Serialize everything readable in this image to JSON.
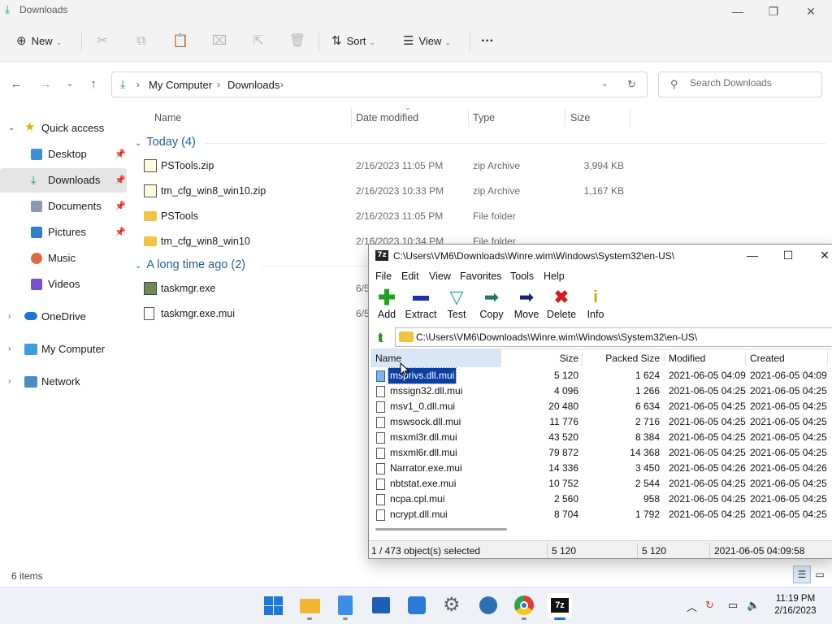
{
  "explorer": {
    "title": "Downloads",
    "commands": {
      "new": "New",
      "sort": "Sort",
      "view": "View",
      "more": "···"
    },
    "breadcrumb": [
      "My Computer",
      "Downloads"
    ],
    "search_placeholder": "Search Downloads",
    "columns": {
      "name": "Name",
      "date": "Date modified",
      "type": "Type",
      "size": "Size"
    },
    "sidebar": {
      "quick_access": "Quick access",
      "items": [
        {
          "label": "Desktop",
          "pinned": true
        },
        {
          "label": "Downloads",
          "pinned": true,
          "active": true
        },
        {
          "label": "Documents",
          "pinned": true
        },
        {
          "label": "Pictures",
          "pinned": true
        },
        {
          "label": "Music"
        },
        {
          "label": "Videos"
        }
      ],
      "onedrive": "OneDrive",
      "my_computer": "My Computer",
      "network": "Network"
    },
    "groups": [
      {
        "label": "Today (4)",
        "files": [
          {
            "name": "PSTools.zip",
            "date": "2/16/2023 11:05 PM",
            "type": "zip Archive",
            "size": "3,994 KB",
            "icon": "zip-icon"
          },
          {
            "name": "tm_cfg_win8_win10.zip",
            "date": "2/16/2023 10:33 PM",
            "type": "zip Archive",
            "size": "1,167 KB",
            "icon": "zip-icon"
          },
          {
            "name": "PSTools",
            "date": "2/16/2023 11:05 PM",
            "type": "File folder",
            "size": "",
            "icon": "folder-icon"
          },
          {
            "name": "tm_cfg_win8_win10",
            "date": "2/16/2023 10:34 PM",
            "type": "File folder",
            "size": "",
            "icon": "folder-icon"
          }
        ]
      },
      {
        "label": "A long time ago (2)",
        "files": [
          {
            "name": "taskmgr.exe",
            "date": "6/5",
            "type": "",
            "size": "",
            "icon": "exe-icon"
          },
          {
            "name": "taskmgr.exe.mui",
            "date": "6/5",
            "type": "",
            "size": "",
            "icon": "file-icon"
          }
        ]
      }
    ],
    "status": "6 items"
  },
  "sevenzip": {
    "title": "C:\\Users\\VM6\\Downloads\\Winre.wim\\Windows\\System32\\en-US\\",
    "logo": "7z",
    "menu": [
      "File",
      "Edit",
      "View",
      "Favorites",
      "Tools",
      "Help"
    ],
    "toolbar": [
      {
        "label": "Add",
        "icon": "add-icon",
        "color": "#1fa01f"
      },
      {
        "label": "Extract",
        "icon": "extract-icon",
        "color": "#1c2fa8"
      },
      {
        "label": "Test",
        "icon": "test-icon",
        "color": "#1ba6b8"
      },
      {
        "label": "Copy",
        "icon": "copy-arrow-icon",
        "color": "#1a7a5a"
      },
      {
        "label": "Move",
        "icon": "move-arrow-icon",
        "color": "#15207a"
      },
      {
        "label": "Delete",
        "icon": "delete-icon",
        "color": "#d51c1c"
      },
      {
        "label": "Info",
        "icon": "info-icon",
        "color": "#c9a800"
      }
    ],
    "path": "C:\\Users\\VM6\\Downloads\\Winre.wim\\Windows\\System32\\en-US\\",
    "columns": {
      "name": "Name",
      "size": "Size",
      "packed": "Packed Size",
      "modified": "Modified",
      "created": "Created"
    },
    "files": [
      {
        "name": "msprivs.dll.mui",
        "size": "5 120",
        "packed": "1 624",
        "modified": "2021-06-05 04:09",
        "created": "2021-06-05 04:09",
        "selected": true
      },
      {
        "name": "mssign32.dll.mui",
        "size": "4 096",
        "packed": "1 266",
        "modified": "2021-06-05 04:25",
        "created": "2021-06-05 04:25"
      },
      {
        "name": "msv1_0.dll.mui",
        "size": "20 480",
        "packed": "6 634",
        "modified": "2021-06-05 04:25",
        "created": "2021-06-05 04:25"
      },
      {
        "name": "mswsock.dll.mui",
        "size": "11 776",
        "packed": "2 716",
        "modified": "2021-06-05 04:25",
        "created": "2021-06-05 04:25"
      },
      {
        "name": "msxml3r.dll.mui",
        "size": "43 520",
        "packed": "8 384",
        "modified": "2021-06-05 04:25",
        "created": "2021-06-05 04:25"
      },
      {
        "name": "msxml6r.dll.mui",
        "size": "79 872",
        "packed": "14 368",
        "modified": "2021-06-05 04:25",
        "created": "2021-06-05 04:25"
      },
      {
        "name": "Narrator.exe.mui",
        "size": "14 336",
        "packed": "3 450",
        "modified": "2021-06-05 04:26",
        "created": "2021-06-05 04:26"
      },
      {
        "name": "nbtstat.exe.mui",
        "size": "10 752",
        "packed": "2 544",
        "modified": "2021-06-05 04:25",
        "created": "2021-06-05 04:25"
      },
      {
        "name": "ncpa.cpl.mui",
        "size": "2 560",
        "packed": "958",
        "modified": "2021-06-05 04:25",
        "created": "2021-06-05 04:25"
      },
      {
        "name": "ncrypt.dll.mui",
        "size": "8 704",
        "packed": "1 792",
        "modified": "2021-06-05 04:25",
        "created": "2021-06-05 04:25"
      }
    ],
    "status": {
      "selection": "1 / 473 object(s) selected",
      "size": "5 120",
      "packed": "5 120",
      "modified": "2021-06-05 04:09:58"
    }
  },
  "taskbar": {
    "apps": [
      "start-icon",
      "file-explorer-icon",
      "notepad-icon",
      "store-icon",
      "photos-icon",
      "settings-icon",
      "network-tool-icon",
      "chrome-icon",
      "7zip-icon"
    ],
    "active_app": "7zip-icon",
    "time": "11:19 PM",
    "date": "2/16/2023"
  },
  "colors": {
    "accent": "#1a6fd1",
    "group_header": "#1f5fa3",
    "selection": "#0a3fa6",
    "download_green": "#1a9f4a"
  }
}
